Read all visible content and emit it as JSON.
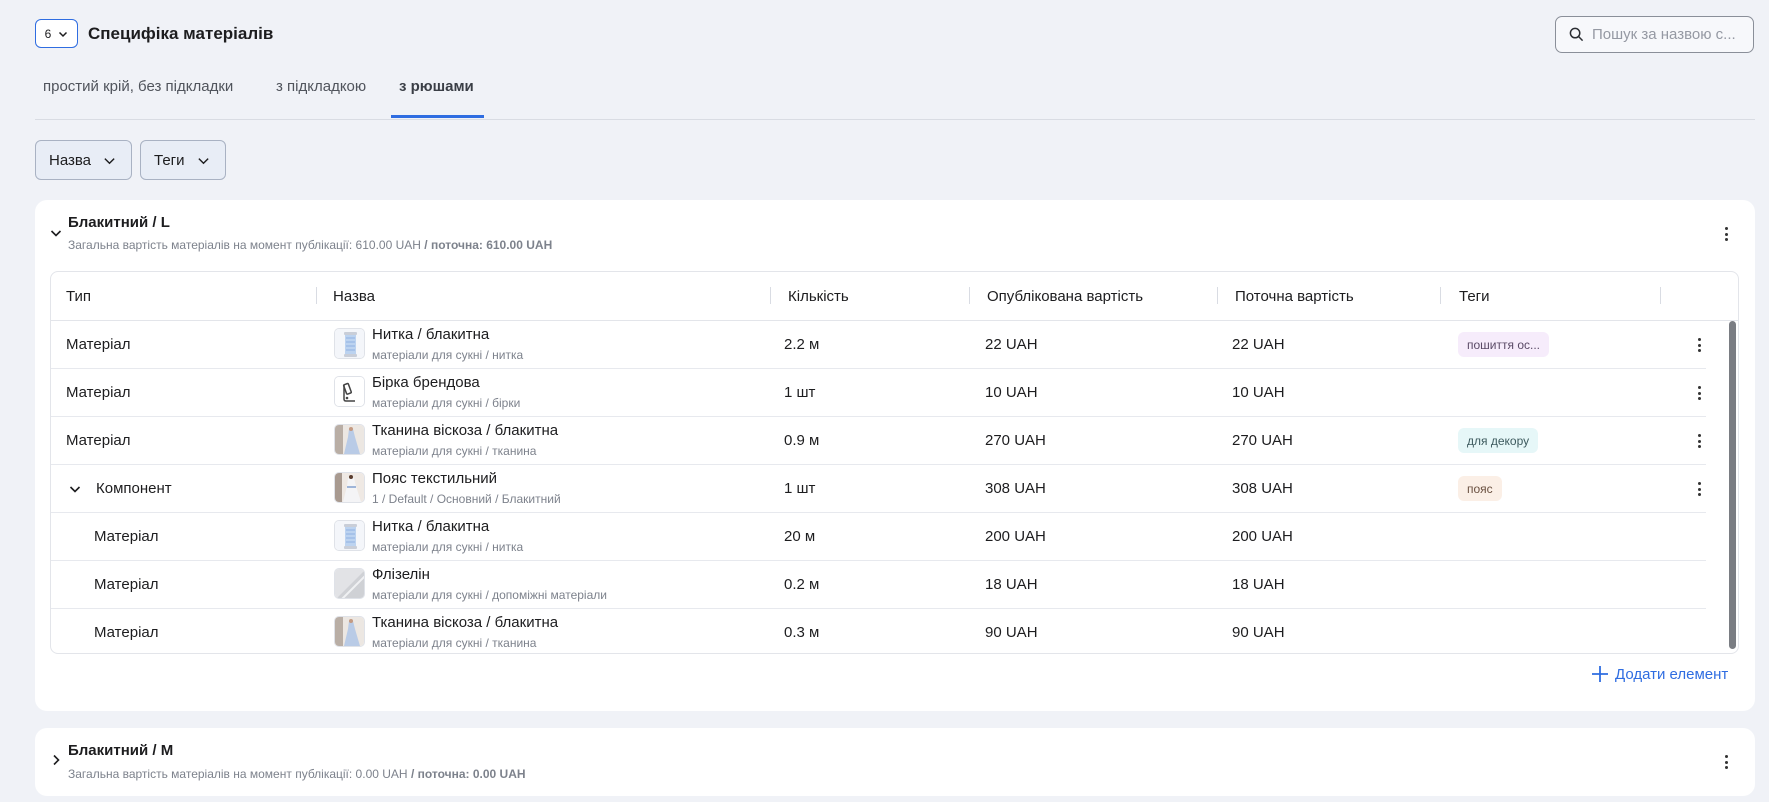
{
  "header": {
    "count_value": "6",
    "title": "Специфіка матеріалів",
    "search_placeholder": "Пошук за назвою с..."
  },
  "tabs": [
    {
      "label": "простий крій, без підкладки",
      "active": false
    },
    {
      "label": "з підкладкою",
      "active": false
    },
    {
      "label": "з рюшами",
      "active": true
    }
  ],
  "filters": [
    {
      "label": "Назва"
    },
    {
      "label": "Теги"
    }
  ],
  "cards": [
    {
      "title": "Блакитний / L",
      "subtitle_prefix": "Загальна вартість матеріалів на момент публікації: 610.00 UAH",
      "subtitle_current": "/ поточна: 610.00 UAH",
      "expanded": true,
      "columns": [
        "Тип",
        "Назва",
        "Кількість",
        "Опублікована вартість",
        "Поточна вартість",
        "Теги"
      ],
      "rows": [
        {
          "type": "Матеріал",
          "name": "Нитка / блакитна",
          "path": "матеріали для сукні / нитка",
          "qty": "2.2 м",
          "published": "22 UAH",
          "current": "22 UAH",
          "tag": "пошиття ос...",
          "tag_color": "#f6ecfb",
          "tag_text_color": "#5a4a66",
          "thumb": "spool",
          "kebab": true,
          "indent": false,
          "component": false
        },
        {
          "type": "Матеріал",
          "name": "Бірка брендова",
          "path": "матеріали для сукні / бірки",
          "qty": "1 шт",
          "published": "10 UAH",
          "current": "10 UAH",
          "tag": "",
          "thumb": "swatch",
          "kebab": true,
          "indent": false,
          "component": false
        },
        {
          "type": "Матеріал",
          "name": "Тканина віскоза / блакитна",
          "path": "матеріали для сукні / тканина",
          "qty": "0.9 м",
          "published": "270 UAH",
          "current": "270 UAH",
          "tag": "для декору",
          "tag_color": "#e6f7f8",
          "tag_text_color": "#3d5a5e",
          "thumb": "dress",
          "kebab": true,
          "indent": false,
          "component": false
        },
        {
          "type": "Компонент",
          "name": "Пояс текстильний",
          "path": "1 / Default / Основний / Блакитний",
          "qty": "1 шт",
          "published": "308 UAH",
          "current": "308 UAH",
          "tag": "пояс",
          "tag_color": "#fbefe6",
          "tag_text_color": "#6b5141",
          "thumb": "dress2",
          "kebab": true,
          "indent": false,
          "component": true
        },
        {
          "type": "Матеріал",
          "name": "Нитка / блакитна",
          "path": "матеріали для сукні / нитка",
          "qty": "20 м",
          "published": "200 UAH",
          "current": "200 UAH",
          "tag": "",
          "thumb": "spool",
          "kebab": false,
          "indent": true,
          "component": false
        },
        {
          "type": "Матеріал",
          "name": "Флізелін",
          "path": "матеріали для сукні / допоміжні матеріали",
          "qty": "0.2 м",
          "published": "18 UAH",
          "current": "18 UAH",
          "tag": "",
          "thumb": "fabric",
          "kebab": false,
          "indent": true,
          "component": false
        },
        {
          "type": "Матеріал",
          "name": "Тканина віскоза / блакитна",
          "path": "матеріали для сукні / тканина",
          "qty": "0.3 м",
          "published": "90 UAH",
          "current": "90 UAH",
          "tag": "",
          "thumb": "dress",
          "kebab": false,
          "indent": true,
          "component": false
        }
      ],
      "add_label": "Додати елемент"
    },
    {
      "title": "Блакитний / M",
      "subtitle_prefix": "Загальна вартість матеріалів на момент публікації: 0.00 UAH",
      "subtitle_current": "/ поточна: 0.00 UAH",
      "expanded": false
    }
  ],
  "colors": {
    "accent": "#2f6de1",
    "background": "#f0f2f7"
  }
}
